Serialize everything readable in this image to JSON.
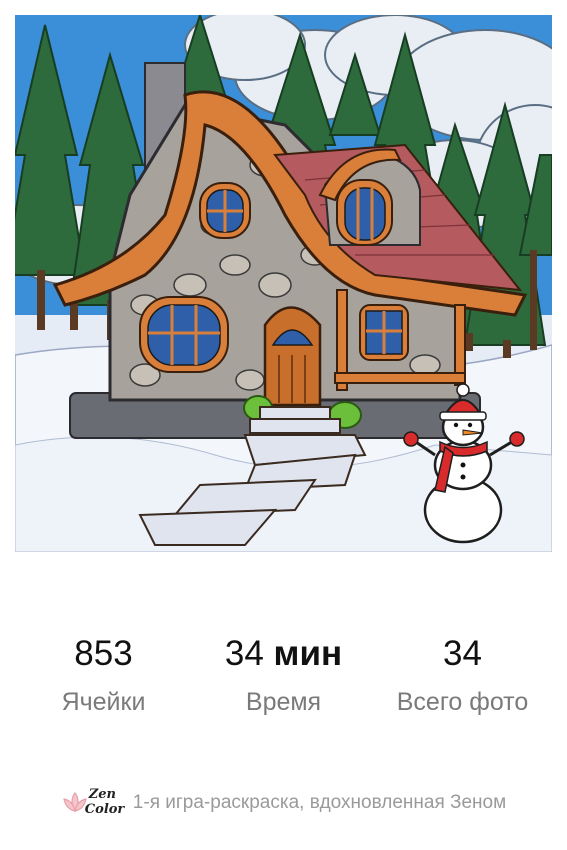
{
  "artwork": {
    "icon": "snowy-stone-cottage-coloring-image"
  },
  "stats": {
    "cells": {
      "value": "853",
      "label": "Ячейки"
    },
    "time": {
      "value": "34",
      "unit": "мин",
      "label": "Время"
    },
    "photos": {
      "value": "34",
      "label": "Всего фото"
    }
  },
  "footer": {
    "logo_zen": "Zen",
    "logo_color": "Color",
    "tagline": "1-я игра-раскраска, вдохновленная Зеном"
  },
  "colors": {
    "stat_value": "#111111",
    "stat_label": "#7a7a7a",
    "tagline": "#9a9a9a",
    "logo_accent": "#e8a0a8"
  }
}
